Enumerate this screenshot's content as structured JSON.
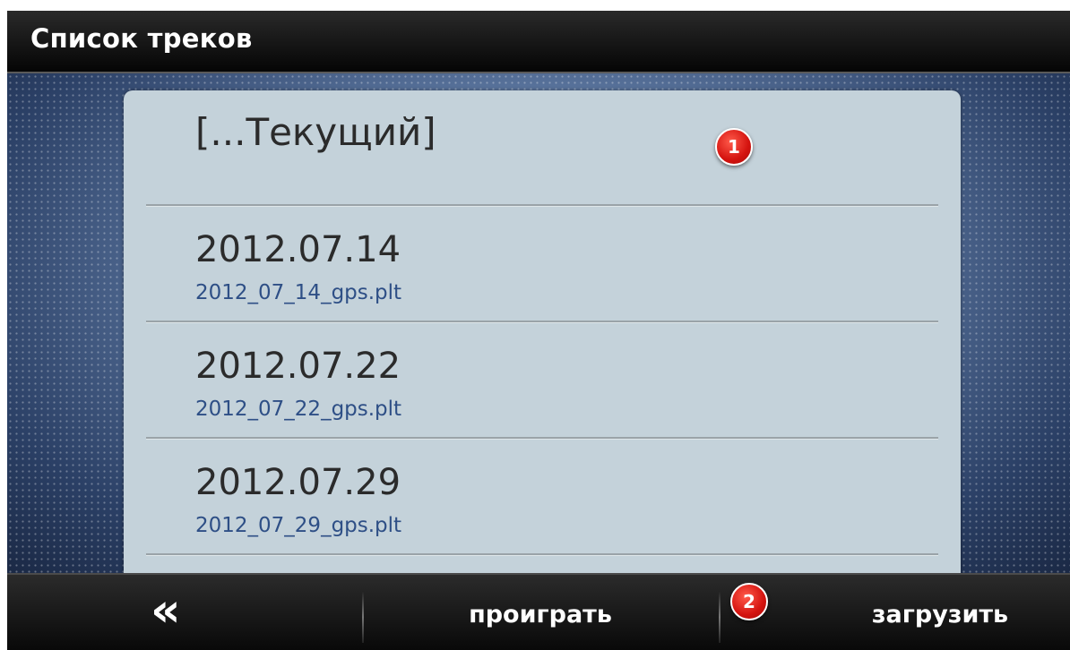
{
  "header": {
    "title": "Список треков"
  },
  "list": {
    "current_label": "[...Текущий]",
    "tracks": [
      {
        "date": "2012.07.14",
        "file": "2012_07_14_gps.plt"
      },
      {
        "date": "2012.07.22",
        "file": "2012_07_22_gps.plt"
      },
      {
        "date": "2012.07.29",
        "file": "2012_07_29_gps.plt"
      }
    ]
  },
  "footer": {
    "back_icon": "«",
    "play_label": "проиграть",
    "load_label": "загрузить"
  },
  "callouts": {
    "first": "1",
    "second": "2"
  },
  "colors": {
    "callout": "#d4130f",
    "file_link": "#2e4f86",
    "panel": "#c4d2da"
  }
}
